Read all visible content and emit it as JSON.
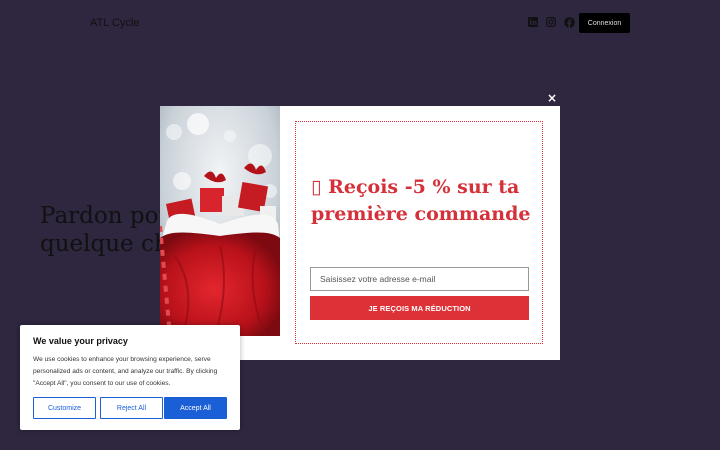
{
  "header": {
    "site_title": "ATL Cycle",
    "social_icons": [
      "linkedin-icon",
      "instagram-icon",
      "facebook-icon"
    ],
    "login_label": "Connexion"
  },
  "background": {
    "heading_line1": "Pardon pour",
    "heading_line2": "quelque cho"
  },
  "popup": {
    "close_symbol": "×",
    "headline_prefix": "▯",
    "headline": "Reçois -5 % sur ta première commande",
    "email_placeholder": "Saisissez votre adresse e-mail",
    "submit_label": "JE REÇOIS MA RÉDUCTION",
    "accent_color": "#d4313b"
  },
  "cookie": {
    "title": "We value your privacy",
    "text": "We use cookies to enhance your browsing experience, serve personalized ads or content, and analyze our traffic. By clicking \"Accept All\", you consent to our use of cookies.",
    "customize_label": "Customize",
    "reject_label": "Reject All",
    "accept_label": "Accept All",
    "accent_color": "#1a5fd6"
  }
}
